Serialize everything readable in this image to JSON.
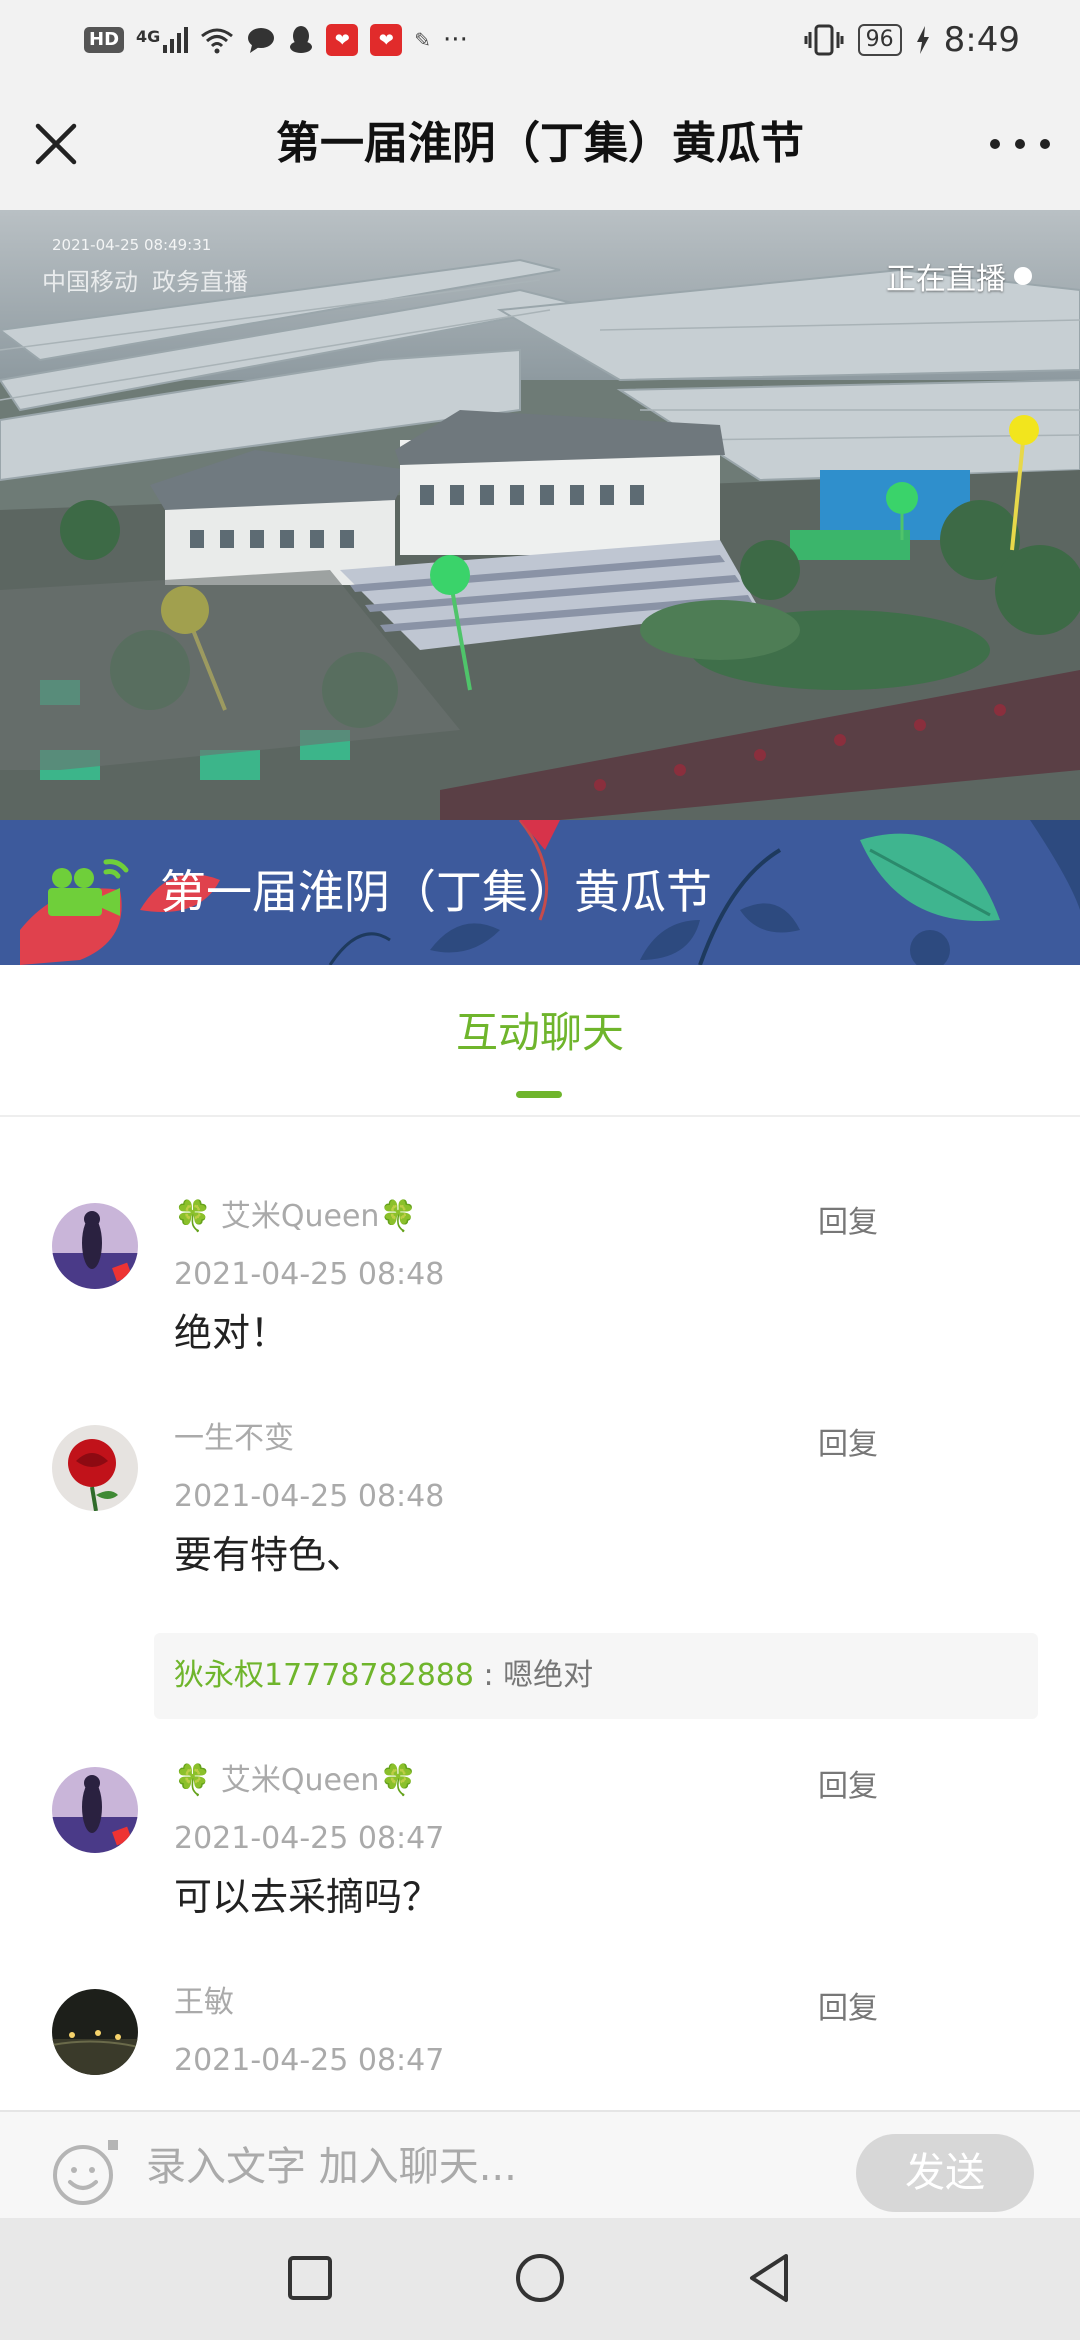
{
  "status_bar": {
    "left_icons": [
      "hd-icon",
      "4g-signal-icon",
      "wifi-icon",
      "chat-bubble-icon",
      "qq-icon",
      "app-red-icon",
      "app-red-icon",
      "app-icon"
    ],
    "hd": "HD",
    "net": "4G",
    "overflow": "···",
    "battery": "96",
    "time": "8:49"
  },
  "header": {
    "title": "第一届淮阴（丁集）黄瓜节",
    "close_icon": "close-icon",
    "more_icon": "more-horizontal-icon"
  },
  "video": {
    "live_label": "正在直播",
    "watermark_time": "2021-04-25  08:49:31",
    "watermark_brand": "中国移动",
    "watermark_service": "政务直播"
  },
  "banner": {
    "title": "第一届淮阴（丁集）黄瓜节",
    "icon": "video-camera-icon"
  },
  "tabs": {
    "active_label": "互动聊天"
  },
  "comments": [
    {
      "name": "🍀 艾米Queen🍀",
      "time": "2021-04-25 08:48",
      "text": "绝对！",
      "reply": "回复"
    },
    {
      "name": "一生不变",
      "time": "2021-04-25 08:48",
      "text": "要有特色、",
      "reply": "回复",
      "quote_user": "狄永权17778782888",
      "quote_sep": " : ",
      "quote_text": "嗯绝对"
    },
    {
      "name": "🍀 艾米Queen🍀",
      "time": "2021-04-25 08:47",
      "text": "可以去采摘吗？",
      "reply": "回复"
    },
    {
      "name": "王敏",
      "time": "2021-04-25 08:47",
      "text": "",
      "reply": "回复"
    }
  ],
  "input_bar": {
    "placeholder": "录入文字 加入聊天...",
    "send_label": "发送",
    "emoji_icon": "emoji-icon"
  },
  "nav_bar": {
    "icons": [
      "recent-apps-icon",
      "home-icon",
      "back-icon"
    ]
  },
  "colors": {
    "accent_green": "#6fb52c",
    "banner_blue": "#3d5a9c",
    "header_bg": "#f2f2f2"
  }
}
